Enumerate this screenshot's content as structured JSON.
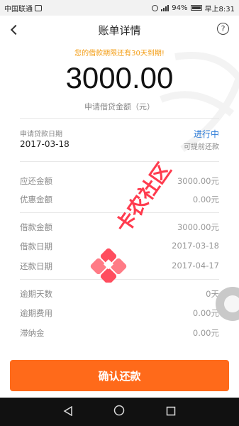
{
  "status_bar": {
    "carrier": "中国联通",
    "battery": "94%",
    "time": "早上8:31"
  },
  "nav": {
    "title": "账单详情",
    "help_symbol": "?"
  },
  "notice": "您的借款期限还有30天到期!",
  "amount": {
    "value": "3000.00",
    "label": "申请借贷金额（元）"
  },
  "application": {
    "date_label": "申请贷款日期",
    "date": "2017-03-18",
    "status": "进行中",
    "hint": "可提前还款"
  },
  "rows_group1": [
    {
      "label": "应还金额",
      "value": "3000.00元"
    },
    {
      "label": "优惠金额",
      "value": "0.00元"
    }
  ],
  "rows_group2": [
    {
      "label": "借款金额",
      "value": "3000.00元"
    },
    {
      "label": "借款日期",
      "value": "2017-03-18"
    },
    {
      "label": "还款日期",
      "value": "2017-04-17"
    }
  ],
  "rows_group3": [
    {
      "label": "逾期天数",
      "value": "0天"
    },
    {
      "label": "逾期费用",
      "value": "0.00元"
    },
    {
      "label": "滞纳金",
      "value": "0.00元"
    }
  ],
  "watermark_text": "卡农社区",
  "confirm_button": "确认还款",
  "colors": {
    "accent": "#ff6a1a",
    "status_blue": "#2b7bd8",
    "notice_orange": "#f39c12"
  }
}
